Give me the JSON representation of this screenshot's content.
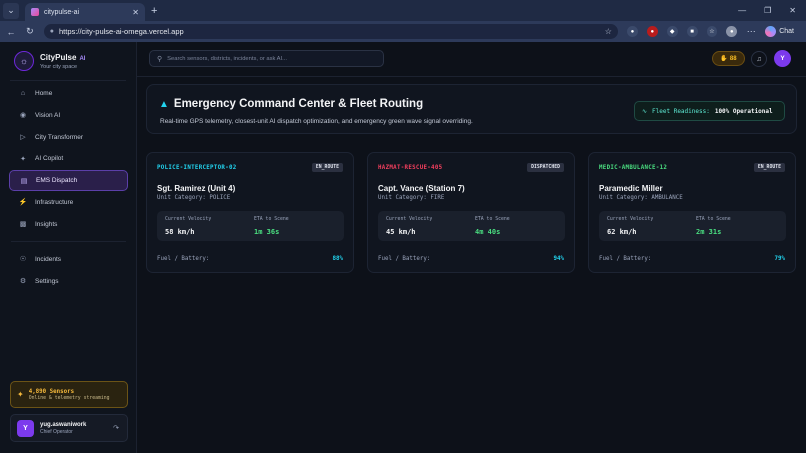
{
  "browser": {
    "tab_title": "citypulse-ai",
    "url": "https://city-pulse-ai-omega.vercel.app",
    "chat_label": "Chat"
  },
  "brand": {
    "name": "CityPulse",
    "ai_tag": "AI",
    "subtitle": "Your city space"
  },
  "nav": {
    "primary": [
      {
        "label": "Home",
        "icon": "home-icon"
      },
      {
        "label": "Vision AI",
        "icon": "eye-icon"
      },
      {
        "label": "City Transformer",
        "icon": "play-icon"
      },
      {
        "label": "AI Copilot",
        "icon": "copilot-icon"
      },
      {
        "label": "EMS Dispatch",
        "icon": "ems-icon",
        "active": true
      },
      {
        "label": "Infrastructure",
        "icon": "bolt-icon"
      },
      {
        "label": "Insights",
        "icon": "chart-icon"
      }
    ],
    "secondary": [
      {
        "label": "Incidents",
        "icon": "shield-icon"
      },
      {
        "label": "Settings",
        "icon": "gear-icon"
      }
    ]
  },
  "sensors": {
    "title": "4,890 Sensors",
    "subtitle": "Online & telemetry streaming"
  },
  "user": {
    "initial": "Y",
    "name": "yug.aswaniwork",
    "role": "Chief Operator"
  },
  "topbar": {
    "search_placeholder": "Search sensors, districts, incidents, or ask AI...",
    "coins": "88",
    "avatar_initial": "Y"
  },
  "hero": {
    "title": "Emergency Command Center & Fleet Routing",
    "subtitle": "Real-time GPS telemetry, closest-unit AI dispatch optimization, and emergency green wave signal overriding.",
    "readiness_label": "Fleet Readiness:",
    "readiness_value": "100% Operational"
  },
  "units": [
    {
      "id": "POLICE-INTERCEPTOR-02",
      "id_color": "#22d3ee",
      "status": "EN_ROUTE",
      "name": "Sgt. Ramirez (Unit 4)",
      "category": "Unit Category: POLICE",
      "velocity_label": "Current Velocity",
      "velocity": "58 km/h",
      "eta_label": "ETA to Scene",
      "eta": "1m 36s",
      "fuel_label": "Fuel / Battery:",
      "fuel": "88%"
    },
    {
      "id": "HAZMAT-RESCUE-405",
      "id_color": "#f43f5e",
      "status": "DISPATCHED",
      "name": "Capt. Vance (Station 7)",
      "category": "Unit Category: FIRE",
      "velocity_label": "Current Velocity",
      "velocity": "45 km/h",
      "eta_label": "ETA to Scene",
      "eta": "4m 40s",
      "fuel_label": "Fuel / Battery:",
      "fuel": "94%"
    },
    {
      "id": "MEDIC-AMBULANCE-12",
      "id_color": "#4ade80",
      "status": "EN_ROUTE",
      "name": "Paramedic Miller",
      "category": "Unit Category: AMBULANCE",
      "velocity_label": "Current Velocity",
      "velocity": "62 km/h",
      "eta_label": "ETA to Scene",
      "eta": "2m 31s",
      "fuel_label": "Fuel / Battery:",
      "fuel": "79%"
    }
  ],
  "colors": {
    "accent": "#7c3aed",
    "eta": "#4ade80",
    "fuel": "#22d3ee"
  }
}
